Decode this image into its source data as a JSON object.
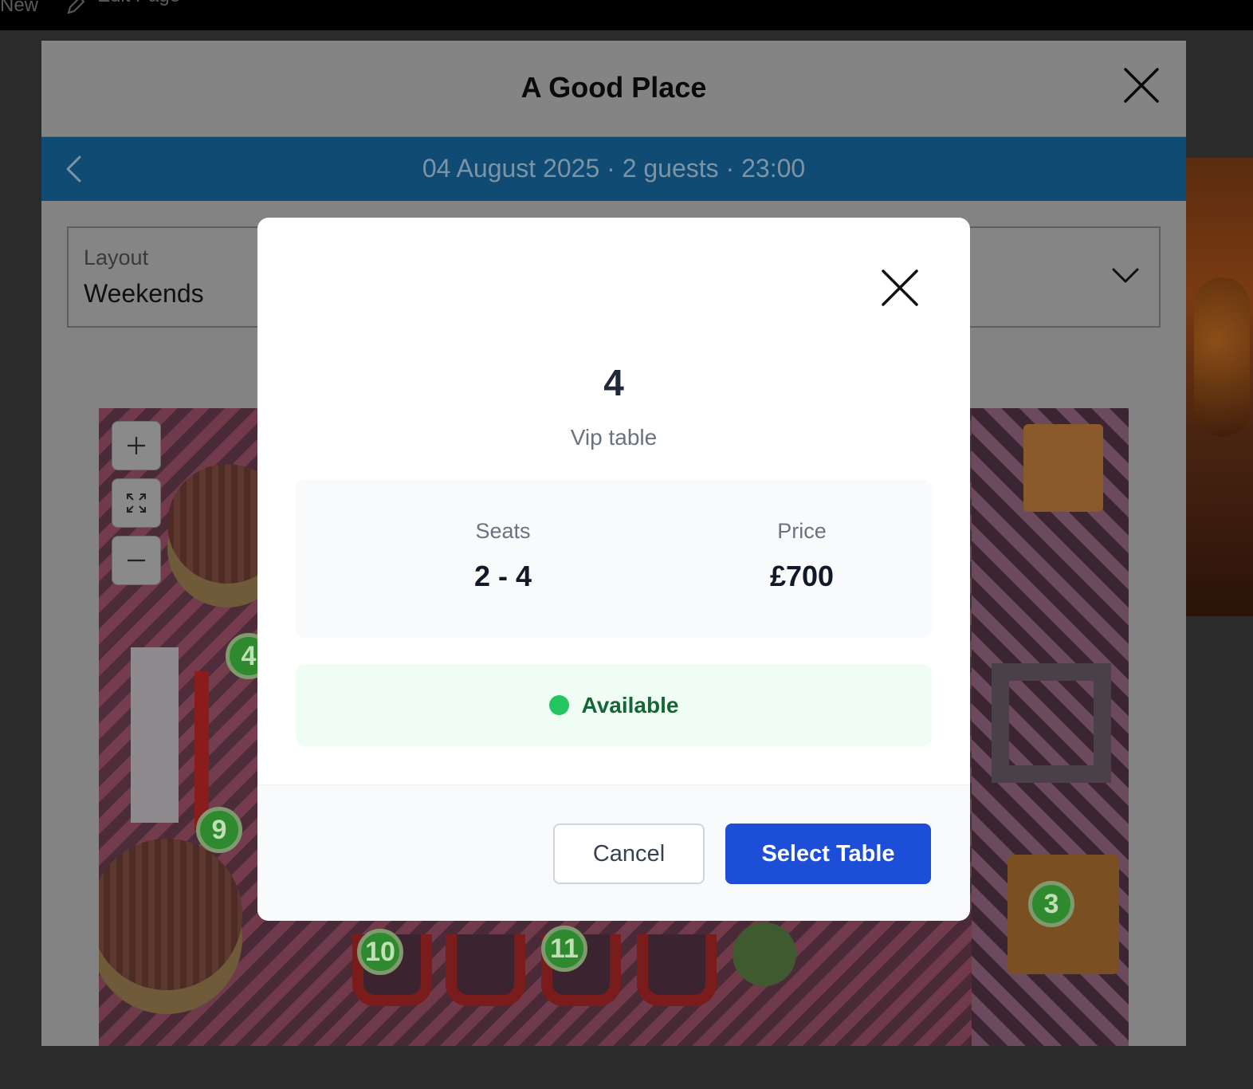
{
  "admin_bar": {
    "new_label": "New",
    "edit_label": "Edit Page"
  },
  "booking": {
    "title": "A Good Place",
    "date_summary": "04 August 2025 · 2 guests · 23:00",
    "layout": {
      "label": "Layout",
      "value": "Weekends"
    },
    "map": {
      "controls": [
        "zoom-in",
        "fullscreen",
        "zoom-out"
      ],
      "table_pins": [
        "4",
        "9",
        "10",
        "11",
        "3"
      ]
    }
  },
  "dialog": {
    "table_number": "4",
    "table_type": "Vip table",
    "seats_label": "Seats",
    "seats_value": "2 - 4",
    "price_label": "Price",
    "price_value": "£700",
    "status": "Available",
    "cancel_label": "Cancel",
    "select_label": "Select Table"
  },
  "colors": {
    "accent_blue": "#1d4ed8",
    "date_bar": "#0f4b73",
    "status_green": "#22c55e",
    "pin_green": "#2f8a2f"
  }
}
